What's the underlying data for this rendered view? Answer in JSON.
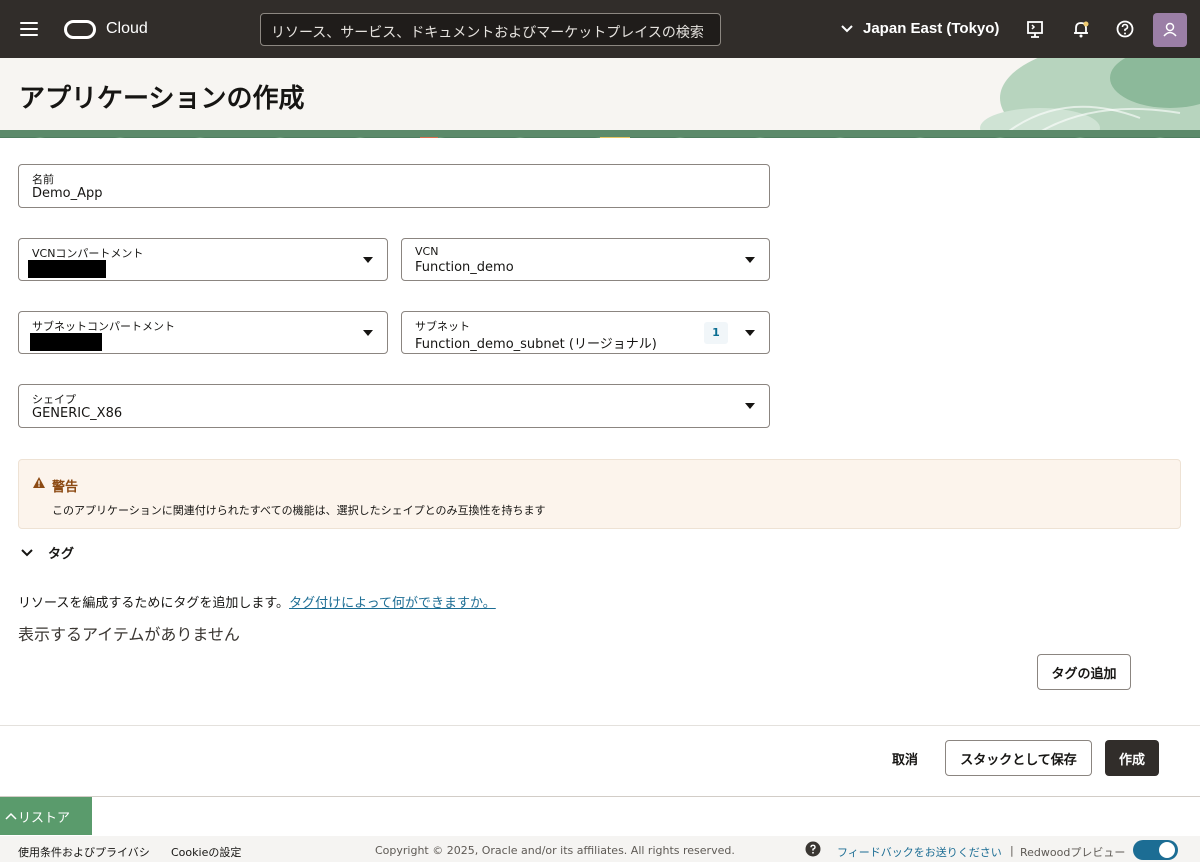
{
  "topbar": {
    "logo_text": "Cloud",
    "search_placeholder": "リソース、サービス、ドキュメントおよびマーケットプレイスの検索",
    "region": "Japan East (Tokyo)"
  },
  "page": {
    "title": "アプリケーションの作成"
  },
  "form": {
    "name": {
      "label": "名前",
      "value": "Demo_App"
    },
    "vcn_compartment": {
      "label": "VCNコンパートメント",
      "value": ""
    },
    "vcn": {
      "label": "VCN",
      "value": "Function_demo"
    },
    "subnet_compartment": {
      "label": "サブネットコンパートメント",
      "value": ""
    },
    "subnet": {
      "label": "サブネット",
      "value": "Function_demo_subnet (リージョナル)",
      "count": "1"
    },
    "shape": {
      "label": "シェイプ",
      "value": "GENERIC_X86"
    }
  },
  "warning": {
    "title": "警告",
    "message": "このアプリケーションに関連付けられたすべての機能は、選択したシェイプとのみ互換性を持ちます"
  },
  "tags": {
    "section_label": "タグ",
    "description": "リソースを編成するためにタグを追加します。",
    "help_link": "タグ付けによって何ができますか。",
    "empty_text": "表示するアイテムがありません",
    "add_button": "タグの追加"
  },
  "actions": {
    "cancel": "取消",
    "save_as_stack": "スタックとして保存",
    "create": "作成"
  },
  "restore": {
    "label": "リストア"
  },
  "footer": {
    "terms": "使用条件およびプライバシ",
    "cookie": "Cookieの設定",
    "copyright": "Copyright © 2025, Oracle and/or its affiliates. All rights reserved.",
    "feedback": "フィードバックをお送りください",
    "separator": "|",
    "redwood": "Redwoodプレビュー"
  },
  "colors": {
    "topbar": "#312d2a",
    "accent_green": "#5a9b6c",
    "link": "#1c6d94",
    "warning_bg": "#fcf4ec",
    "warning_text": "#8c4a13"
  }
}
